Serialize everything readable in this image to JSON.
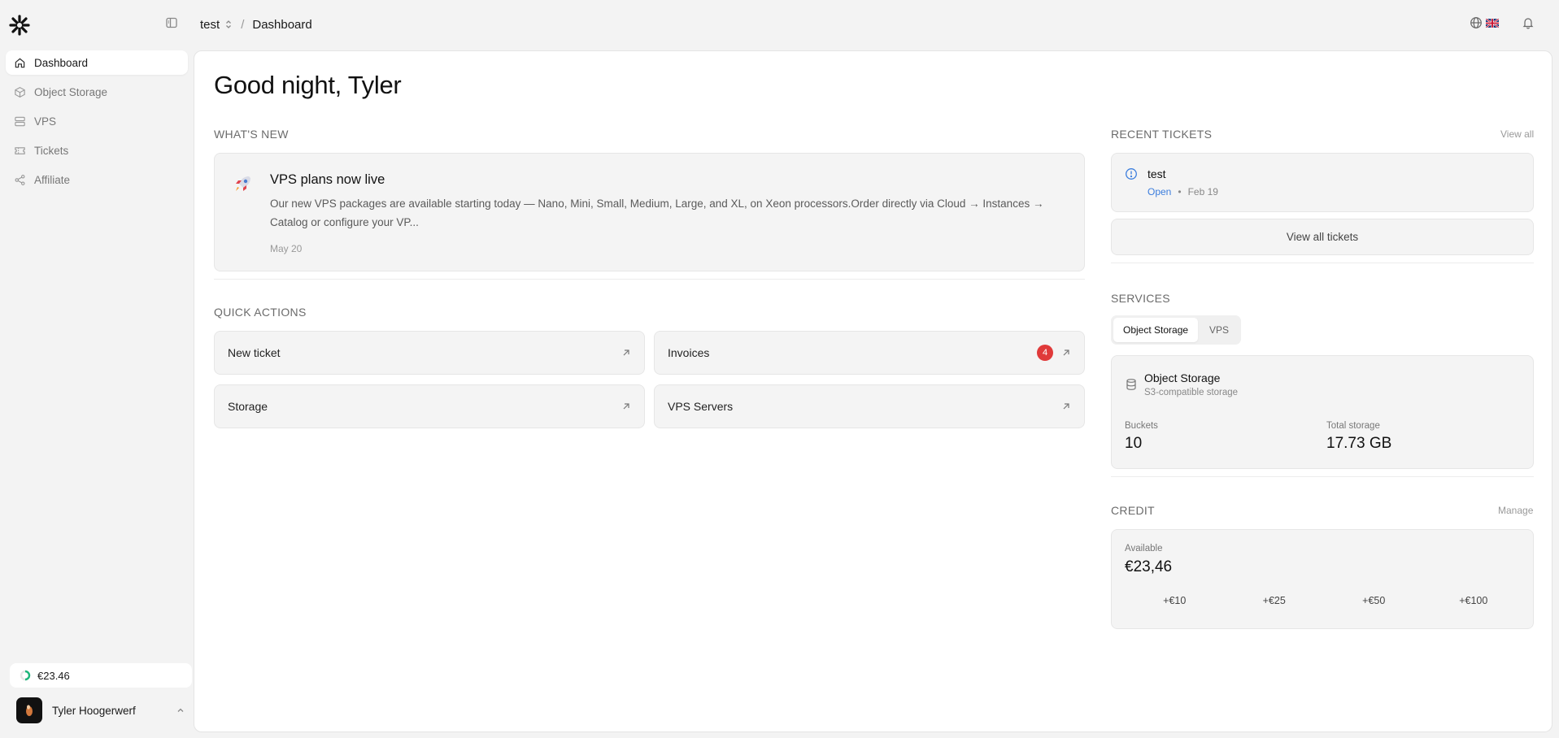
{
  "header": {
    "project": "test",
    "separator": "/",
    "page": "Dashboard"
  },
  "sidebar": {
    "items": [
      {
        "label": "Dashboard",
        "icon": "home-icon",
        "active": true
      },
      {
        "label": "Object Storage",
        "icon": "box-icon",
        "active": false
      },
      {
        "label": "VPS",
        "icon": "server-icon",
        "active": false
      },
      {
        "label": "Tickets",
        "icon": "ticket-icon",
        "active": false
      },
      {
        "label": "Affiliate",
        "icon": "share-icon",
        "active": false
      }
    ],
    "credit": "€23.46",
    "user": {
      "name": "Tyler Hoogerwerf"
    }
  },
  "main": {
    "greeting": "Good night, Tyler",
    "whats_new": {
      "label": "What's new",
      "title": "VPS plans now live",
      "body": "Our new VPS packages are available starting today — Nano, Mini, Small, Medium, Large, and XL, on Xeon processors.Order directly via Cloud → Instances → Catalog or configure your VP...",
      "date": "May 20"
    },
    "quick_actions": {
      "label": "Quick actions",
      "items": [
        {
          "label": "New ticket"
        },
        {
          "label": "Invoices",
          "badge": "4"
        },
        {
          "label": "Storage"
        },
        {
          "label": "VPS Servers"
        }
      ]
    },
    "recent_tickets": {
      "label": "Recent tickets",
      "view_all": "View all",
      "ticket": {
        "title": "test",
        "status": "Open",
        "dot": "•",
        "date": "Feb 19"
      },
      "view_all_button": "View all tickets"
    },
    "services": {
      "label": "Services",
      "tabs": [
        "Object Storage",
        "VPS"
      ],
      "card": {
        "title": "Object Storage",
        "subtitle": "S3-compatible storage",
        "buckets_label": "Buckets",
        "buckets_value": "10",
        "total_label": "Total storage",
        "total_value": "17.73 GB"
      }
    },
    "credit": {
      "label": "Credit",
      "manage": "Manage",
      "available_label": "Available",
      "amount": "€23,46",
      "topups": [
        "+€10",
        "+€25",
        "+€50",
        "+€100"
      ]
    }
  },
  "colors": {
    "accent_blue": "#3b7ddd",
    "badge_red": "#e03a3a",
    "credit_ring": "#1db57a"
  }
}
